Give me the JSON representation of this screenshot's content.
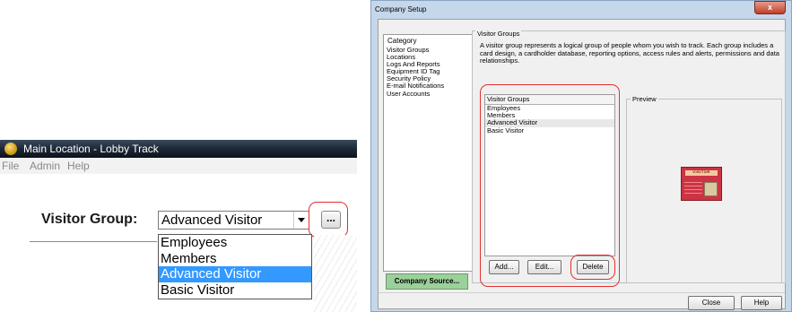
{
  "lobby_track": {
    "title": "Main Location - Lobby Track",
    "menu": [
      "File",
      "Admin",
      "Help"
    ],
    "visitor_group_label": "Visitor Group:",
    "selected_value": "Advanced Visitor",
    "ellipsis_label": "...",
    "dropdown_options": [
      "Employees",
      "Members",
      "Advanced Visitor",
      "Basic Visitor"
    ],
    "selected_index": 2
  },
  "company_setup": {
    "title": "Company Setup",
    "close_glyph": "x",
    "category_header": "Category",
    "categories": [
      "Visitor Groups",
      "Locations",
      "Logs And Reports",
      "Equipment ID Tag",
      "Security Policy",
      "E-mail Notifications",
      "User Accounts"
    ],
    "selected_category_index": 0,
    "company_source_label": "Company Source...",
    "section_title": "Visitor Groups",
    "description": "A visitor group represents a logical group of people whom you wish to track. Each group includes a card design, a cardholder database, reporting options, access rules and alerts, permissions and data relationships.",
    "list_header": "Visitor Groups",
    "groups": [
      "Employees",
      "Members",
      "Advanced Visitor",
      "Basic Visitor"
    ],
    "selected_group_index": 2,
    "preview_label": "Preview",
    "card_text": "VISITOR",
    "buttons": {
      "add": "Add...",
      "edit": "Edit...",
      "delete": "Delete",
      "close": "Close",
      "help": "Help"
    }
  },
  "colors": {
    "highlight_box": "#e03030",
    "dropdown_selection": "#3399ff",
    "company_source_bg": "#9bd09b",
    "card_red": "#cc3344"
  }
}
